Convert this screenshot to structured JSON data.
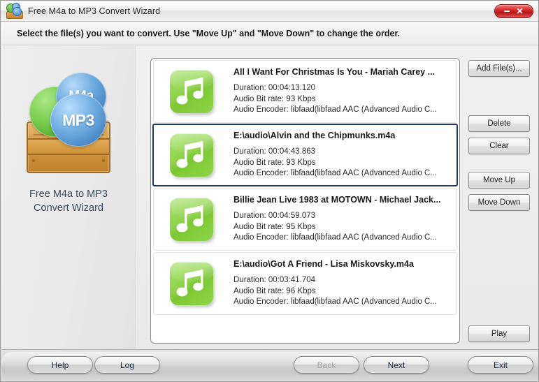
{
  "window": {
    "title": "Free M4a to MP3 Convert Wizard",
    "icon": "app-logo-icon",
    "close_label": "✕",
    "minimize_label": ""
  },
  "header": {
    "instruction": "Select the file(s) you want to convert. Use \"Move Up\" and \"Move Down\" to change the order."
  },
  "brand": {
    "logo_m4a": "M4a",
    "logo_mp3": "MP3",
    "logo_arrow": "←",
    "name": "Free M4a to MP3\nConvert Wizard"
  },
  "files": [
    {
      "title": "All I Want For Christmas Is You - Mariah Carey ...",
      "duration": "Duration: 00:04:13.120",
      "bitrate": "Audio Bit rate: 93 Kbps",
      "encoder": "Audio Encoder: libfaad(libfaad AAC (Advanced Audio C...",
      "selected": false
    },
    {
      "title": "E:\\audio\\Alvin and the Chipmunks.m4a",
      "duration": "Duration: 00:04:43.863",
      "bitrate": "Audio Bit rate: 93 Kbps",
      "encoder": "Audio Encoder: libfaad(libfaad AAC (Advanced Audio C...",
      "selected": true
    },
    {
      "title": "Billie Jean Live 1983 at MOTOWN - Michael Jack...",
      "duration": "Duration: 00:04:59.073",
      "bitrate": "Audio Bit rate: 95 Kbps",
      "encoder": "Audio Encoder: libfaad(libfaad AAC (Advanced Audio C...",
      "selected": false
    },
    {
      "title": "E:\\audio\\Got A Friend - Lisa Miskovsky.m4a",
      "duration": "Duration: 00:03:41.704",
      "bitrate": "Audio Bit rate: 96 Kbps",
      "encoder": "Audio Encoder: libfaad(libfaad AAC (Advanced Audio C...",
      "selected": false
    }
  ],
  "side_buttons": {
    "add_files": "Add File(s)...",
    "delete": "Delete",
    "clear": "Clear",
    "move_up": "Move Up",
    "move_down": "Move Down",
    "play": "Play"
  },
  "bottom_buttons": {
    "help": "Help",
    "log": "Log",
    "back": "Back",
    "next": "Next",
    "exit": "Exit"
  },
  "colors": {
    "accent_green": "#8fd54a",
    "selection_border": "#1f3864",
    "close_red": "#d92b2b",
    "brand_text": "#3b4a5a"
  }
}
